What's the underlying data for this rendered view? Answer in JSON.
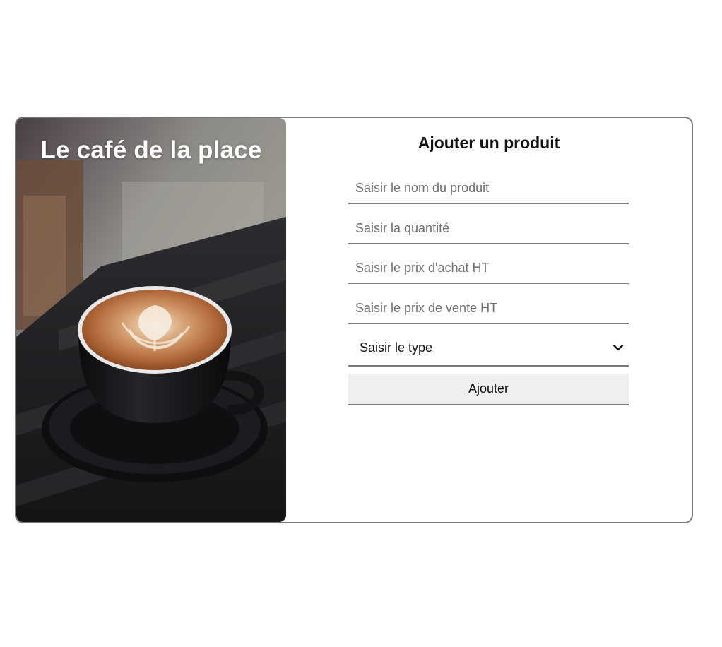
{
  "hero": {
    "title": "Le café de la place",
    "image": "latte-art-coffee-cup-photo"
  },
  "form": {
    "title": "Ajouter un produit",
    "fields": [
      {
        "name": "product-name-input",
        "placeholder": "Saisir le nom du produit",
        "value": ""
      },
      {
        "name": "quantity-input",
        "placeholder": "Saisir la quantité",
        "value": ""
      },
      {
        "name": "purchase-price-input",
        "placeholder": "Saisir le prix d'achat HT",
        "value": ""
      },
      {
        "name": "sale-price-input",
        "placeholder": "Saisir le prix de vente HT",
        "value": ""
      }
    ],
    "type_select": {
      "selected": "Saisir le type",
      "icon": "chevron-down-icon"
    },
    "submit_label": "Ajouter"
  },
  "colors": {
    "border": "#7a7a7a",
    "button_bg": "#efefef",
    "text": "#111111",
    "placeholder": "#6f6f6f"
  }
}
